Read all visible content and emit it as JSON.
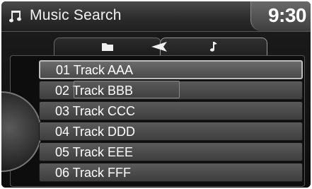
{
  "header": {
    "icon": "music-note-icon",
    "title": "Music Search",
    "clock": "9:30"
  },
  "tabs": [
    {
      "icon": "folder-icon"
    },
    {
      "icon": "music-note-icon"
    }
  ],
  "back_icon": "back-arrow-icon",
  "tracks": [
    {
      "label": "01 Track AAA",
      "selected": true
    },
    {
      "label": "02 Track BBB",
      "selected": false
    },
    {
      "label": "03 Track CCC",
      "selected": false
    },
    {
      "label": "04 Track DDD",
      "selected": false
    },
    {
      "label": "05 Track EEE",
      "selected": false
    },
    {
      "label": "06 Track FFF",
      "selected": false
    }
  ],
  "colors": {
    "background": "#0a0a0a",
    "row": "#4a4a4a",
    "text": "#ffffff"
  }
}
